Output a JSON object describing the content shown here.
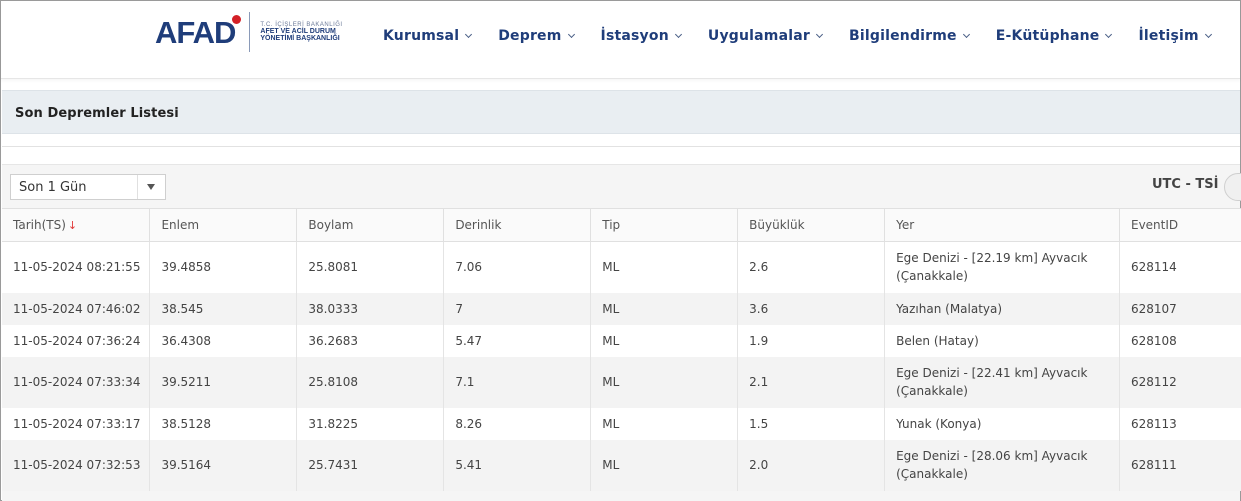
{
  "header": {
    "logo": {
      "word": "AFAD",
      "line1": "T.C. İÇİŞLERİ BAKANLIĞI",
      "line2": "AFET VE ACİL DURUM",
      "line3": "YÖNETİMİ BAŞKANLIĞI"
    },
    "nav": [
      {
        "label": "Kurumsal"
      },
      {
        "label": "Deprem"
      },
      {
        "label": "İstasyon"
      },
      {
        "label": "Uygulamalar"
      },
      {
        "label": "Bilgilendirme"
      },
      {
        "label": "E-Kütüphane"
      },
      {
        "label": "İletişim"
      }
    ],
    "colors": {
      "brand": "#1f3d7a",
      "accent": "#d32027"
    }
  },
  "page": {
    "title": "Son Depremler Listesi"
  },
  "filters": {
    "period_selected": "Son 1 Gün",
    "time_label": "UTC - TSİ"
  },
  "table": {
    "columns": [
      "Tarih(TS)",
      "Enlem",
      "Boylam",
      "Derinlik",
      "Tip",
      "Büyüklük",
      "Yer",
      "EventID"
    ],
    "sort_indicator": "↓",
    "rows": [
      {
        "date": "11-05-2024 08:21:55",
        "lat": "39.4858",
        "lon": "25.8081",
        "depth": "7.06",
        "type": "ML",
        "mag": "2.6",
        "place1": "Ege Denizi - [22.19 km] Ayvacık",
        "place2": "(Çanakkale)",
        "id": "628114"
      },
      {
        "date": "11-05-2024 07:46:02",
        "lat": "38.545",
        "lon": "38.0333",
        "depth": "7",
        "type": "ML",
        "mag": "3.6",
        "place1": "Yazıhan (Malatya)",
        "place2": "",
        "id": "628107"
      },
      {
        "date": "11-05-2024 07:36:24",
        "lat": "36.4308",
        "lon": "36.2683",
        "depth": "5.47",
        "type": "ML",
        "mag": "1.9",
        "place1": "Belen (Hatay)",
        "place2": "",
        "id": "628108"
      },
      {
        "date": "11-05-2024 07:33:34",
        "lat": "39.5211",
        "lon": "25.8108",
        "depth": "7.1",
        "type": "ML",
        "mag": "2.1",
        "place1": "Ege Denizi - [22.41 km] Ayvacık",
        "place2": "(Çanakkale)",
        "id": "628112"
      },
      {
        "date": "11-05-2024 07:33:17",
        "lat": "38.5128",
        "lon": "31.8225",
        "depth": "8.26",
        "type": "ML",
        "mag": "1.5",
        "place1": "Yunak (Konya)",
        "place2": "",
        "id": "628113"
      },
      {
        "date": "11-05-2024 07:32:53",
        "lat": "39.5164",
        "lon": "25.7431",
        "depth": "5.41",
        "type": "ML",
        "mag": "2.0",
        "place1": "Ege Denizi - [28.06 km] Ayvacık",
        "place2": "(Çanakkale)",
        "id": "628111"
      }
    ]
  }
}
